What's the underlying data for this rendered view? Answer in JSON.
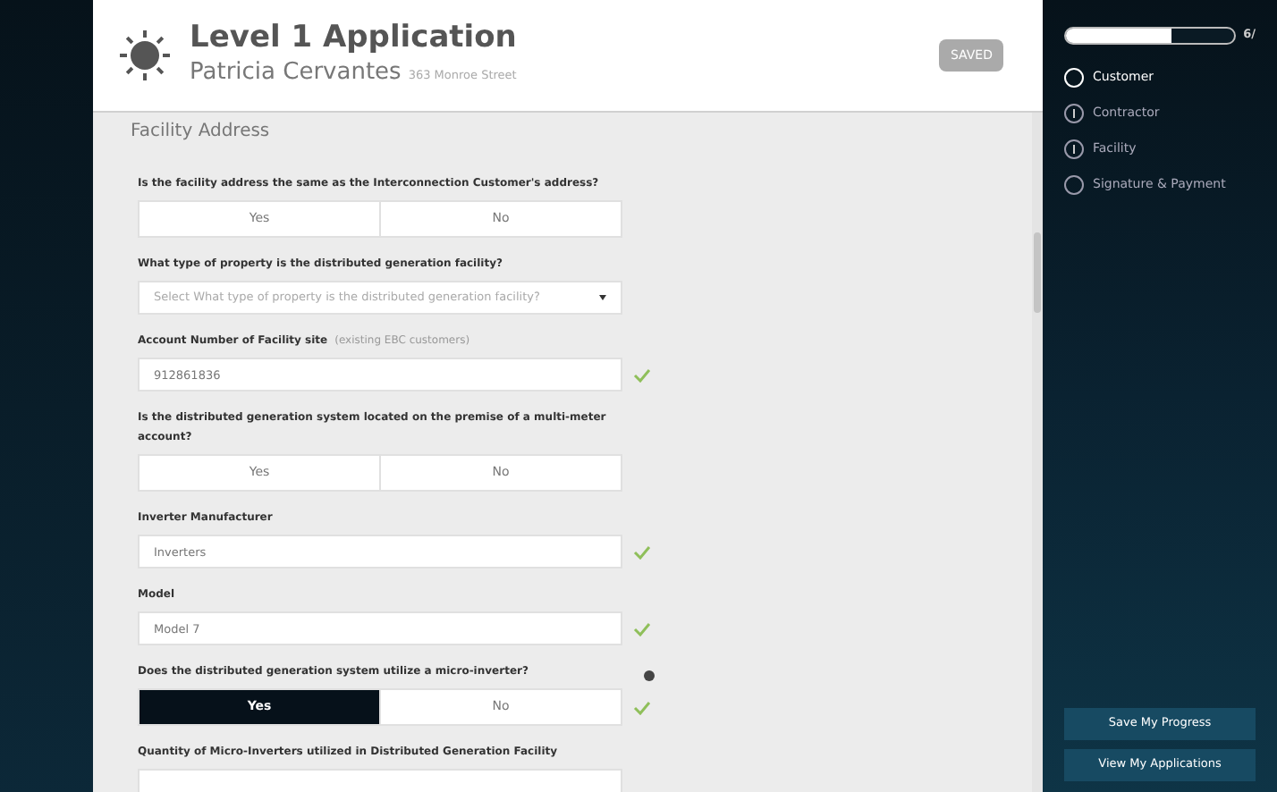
{
  "header": {
    "title": "Level 1 Application",
    "name": "Patricia Cervantes",
    "address": "363 Monroe Street",
    "status": "SAVED"
  },
  "section": {
    "title": "Facility Address"
  },
  "fields": [
    {
      "kind": "choice",
      "label": "Is the facility address the same as the Interconnection Customer's address?",
      "options": [
        {
          "label": "Yes",
          "selected": false
        },
        {
          "label": "No",
          "selected": false
        }
      ],
      "valid": false,
      "info": false
    },
    {
      "kind": "select",
      "label": "What type of property is the distributed generation facility?",
      "placeholder": "Select What type of property is the distributed generation facility?",
      "valid": false,
      "info": false
    },
    {
      "kind": "text",
      "label": "Account Number of Facility site",
      "hint": "(existing EBC customers)",
      "value": "912861836",
      "valid": true,
      "info": false
    },
    {
      "kind": "choice",
      "label": "Is the distributed generation system located on the premise of a multi-meter account?",
      "options": [
        {
          "label": "Yes",
          "selected": false
        },
        {
          "label": "No",
          "selected": false
        }
      ],
      "valid": false,
      "info": false
    },
    {
      "kind": "text",
      "label": "Inverter Manufacturer",
      "value": "Inverters",
      "valid": true,
      "info": false
    },
    {
      "kind": "text",
      "label": "Model",
      "value": "Model 7",
      "valid": true,
      "info": false
    },
    {
      "kind": "choice",
      "label": "Does the distributed generation system utilize a micro-inverter?",
      "options": [
        {
          "label": "Yes",
          "selected": true
        },
        {
          "label": "No",
          "selected": false
        }
      ],
      "valid": true,
      "info": true
    },
    {
      "kind": "text",
      "label": "Quantity of Micro-Inverters utilized in Distributed Generation Facility",
      "valid": false,
      "info": false
    }
  ],
  "sidebar": {
    "progress": {
      "level": 0.63,
      "reading": "6/"
    },
    "steps": [
      {
        "label": "Customer",
        "selected": true,
        "warning": false
      },
      {
        "label": "Contractor",
        "selected": false,
        "warning": true
      },
      {
        "label": "Facility",
        "selected": false,
        "warning": true
      },
      {
        "label": "Signature & Payment",
        "selected": false,
        "warning": false
      }
    ],
    "buttons": [
      "Save My Progress",
      "View My Applications"
    ]
  }
}
